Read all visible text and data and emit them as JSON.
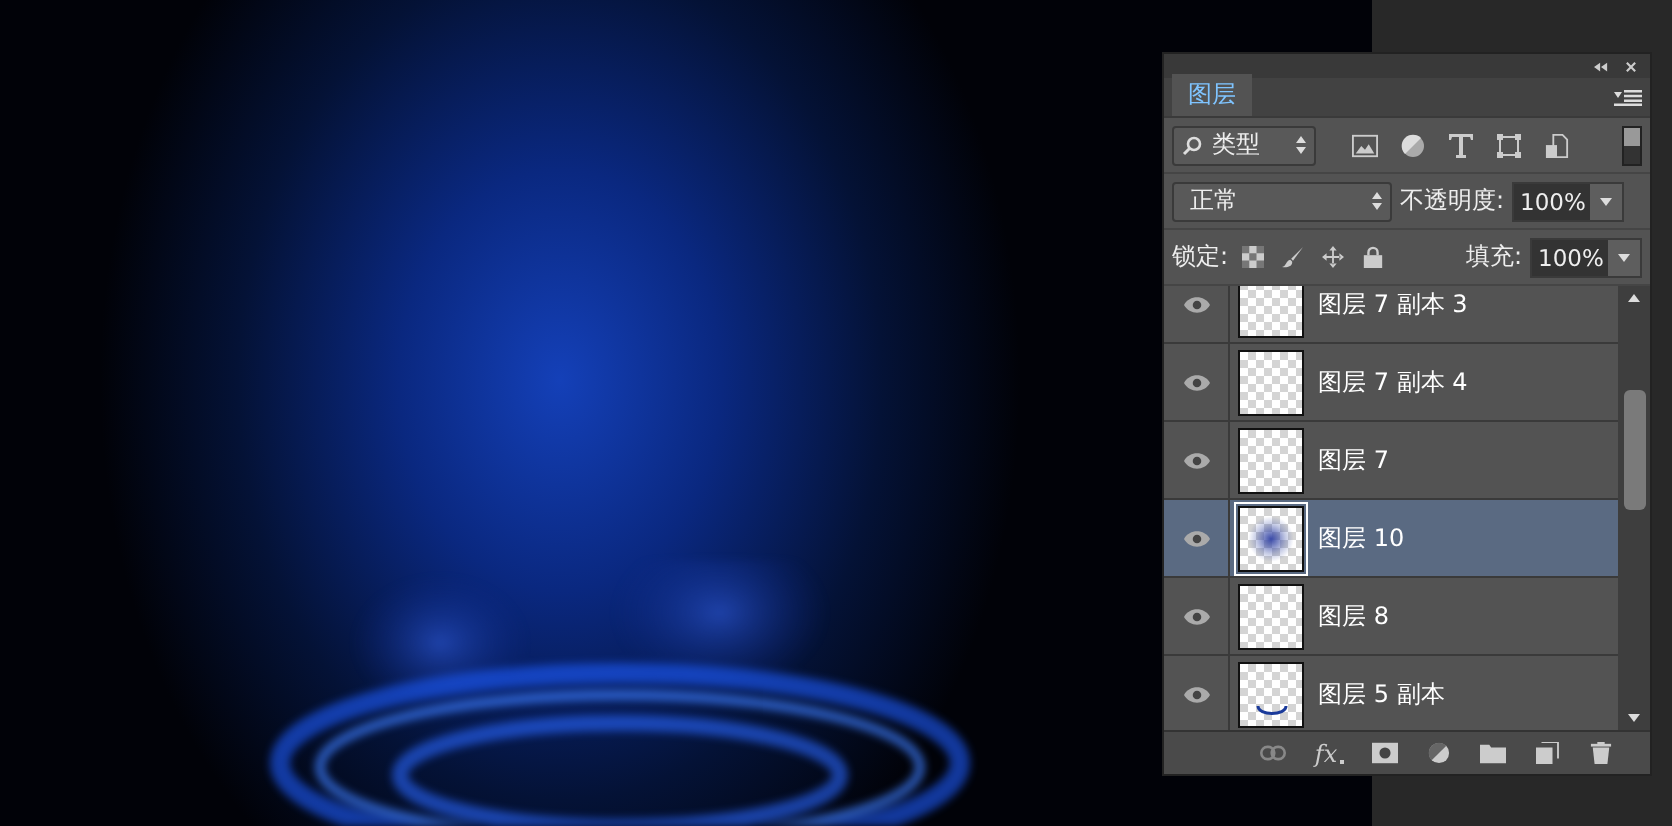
{
  "panel": {
    "tabs": [
      {
        "label": "图层",
        "selected": true
      }
    ],
    "filter": {
      "value": "类型"
    },
    "blend_mode": {
      "value": "正常"
    },
    "opacity": {
      "label": "不透明度:",
      "value": "100%"
    },
    "lock": {
      "label": "锁定:"
    },
    "effects_button": {
      "label": "fx"
    },
    "fill": {
      "label": "填充:",
      "value": "100%"
    },
    "layers": [
      {
        "name": "图层 7 副本 3",
        "visible": true,
        "selected": false,
        "kind": "empty"
      },
      {
        "name": "图层 7 副本 4",
        "visible": true,
        "selected": false,
        "kind": "empty"
      },
      {
        "name": "图层 7",
        "visible": true,
        "selected": false,
        "kind": "empty"
      },
      {
        "name": "图层 10",
        "visible": true,
        "selected": true,
        "kind": "glow"
      },
      {
        "name": "图层 8",
        "visible": true,
        "selected": false,
        "kind": "empty"
      },
      {
        "name": "图层 5 副本",
        "visible": true,
        "selected": false,
        "kind": "arc"
      }
    ]
  }
}
